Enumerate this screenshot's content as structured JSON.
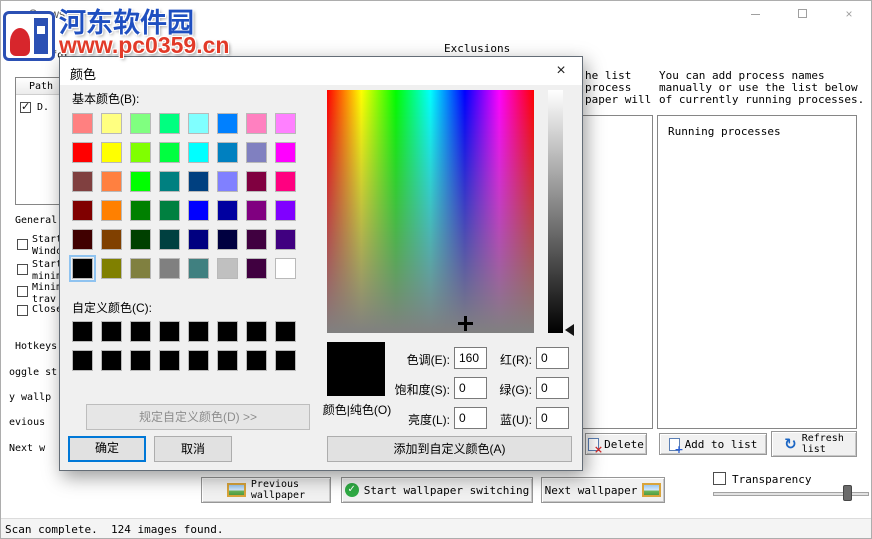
{
  "watermark": {
    "site_name": "河东软件园",
    "site_url": "www.pc0359.cn"
  },
  "window": {
    "title": "Spews",
    "close_glyph": "×",
    "tab_exclusions": "Exclusions",
    "image_folders_fragment": "Image fol",
    "status_text": "Scan complete.  124 images found."
  },
  "left_panel": {
    "path_header": "Path",
    "path_item_label": "D.",
    "general_label": "General",
    "general_items": [
      {
        "line1": "Start",
        "line2": "Windo"
      },
      {
        "line1": "Start",
        "line2": "minim"
      },
      {
        "line1": "Minim",
        "line2": "trav"
      },
      {
        "line1": "Close",
        "line2": ""
      }
    ],
    "hotkeys_label": "Hotkeys",
    "hotkey_fragments": [
      "oggle st",
      "y wallp",
      "evious",
      "Next w"
    ]
  },
  "processes_panel": {
    "clipped_lines": [
      "he list",
      "process",
      "paper will"
    ],
    "info_lines": [
      "You can add process names",
      "manually or use the list below",
      "of currently running processes."
    ],
    "running_header": "Running processes",
    "delete_label": "Delete",
    "add_label": "Add to list",
    "refresh_line1": "Refresh",
    "refresh_line2": "list"
  },
  "bottom_bar": {
    "previous_line1": "Previous",
    "previous_line2": "wallpaper",
    "start_label": "Start wallpaper switching",
    "next_label": "Next wallpaper",
    "transparency_label": "Transparency"
  },
  "color_dialog": {
    "title": "颜色",
    "close_glyph": "×",
    "basic_label": "基本颜色(B):",
    "custom_label": "自定义颜色(C):",
    "define_custom_label": "规定自定义颜色(D) >>",
    "ok_label": "确定",
    "cancel_label": "取消",
    "add_custom_label": "添加到自定义颜色(A)",
    "solid_label": "颜色|纯色(O)",
    "hue_label": "色调(E):",
    "hue_value": "160",
    "sat_label": "饱和度(S):",
    "sat_value": "0",
    "lum_label": "亮度(L):",
    "lum_value": "0",
    "red_label": "红(R):",
    "red_value": "0",
    "green_label": "绿(G):",
    "green_value": "0",
    "blue_label": "蓝(U):",
    "blue_value": "0",
    "selected_index": 40,
    "selected_color": "#000000",
    "basic_colors": [
      "#FF8080",
      "#FFFF80",
      "#80FF80",
      "#00FF80",
      "#80FFFF",
      "#0080FF",
      "#FF80C0",
      "#FF80FF",
      "#FF0000",
      "#FFFF00",
      "#80FF00",
      "#00FF40",
      "#00FFFF",
      "#0080C0",
      "#8080C0",
      "#FF00FF",
      "#804040",
      "#FF8040",
      "#00FF00",
      "#008080",
      "#004080",
      "#8080FF",
      "#800040",
      "#FF0080",
      "#800000",
      "#FF8000",
      "#008000",
      "#008040",
      "#0000FF",
      "#0000A0",
      "#800080",
      "#8000FF",
      "#400000",
      "#804000",
      "#004000",
      "#004040",
      "#000080",
      "#000040",
      "#400040",
      "#400080",
      "#000000",
      "#808000",
      "#808040",
      "#808080",
      "#408080",
      "#C0C0C0",
      "#400040",
      "#FFFFFF"
    ],
    "custom_colors": [
      "#000000",
      "#000000",
      "#000000",
      "#000000",
      "#000000",
      "#000000",
      "#000000",
      "#000000",
      "#000000",
      "#000000",
      "#000000",
      "#000000",
      "#000000",
      "#000000",
      "#000000",
      "#000000"
    ]
  },
  "colors": {
    "accent_blue": "#0078d7",
    "watermark_blue": "#1f4fc0",
    "watermark_red": "#e23a28",
    "start_icon_green": "#2faa44"
  },
  "icons": {
    "check_glyph": "✓",
    "refresh_glyph": "↻",
    "delete_glyph": "×",
    "add_glyph": "+"
  }
}
